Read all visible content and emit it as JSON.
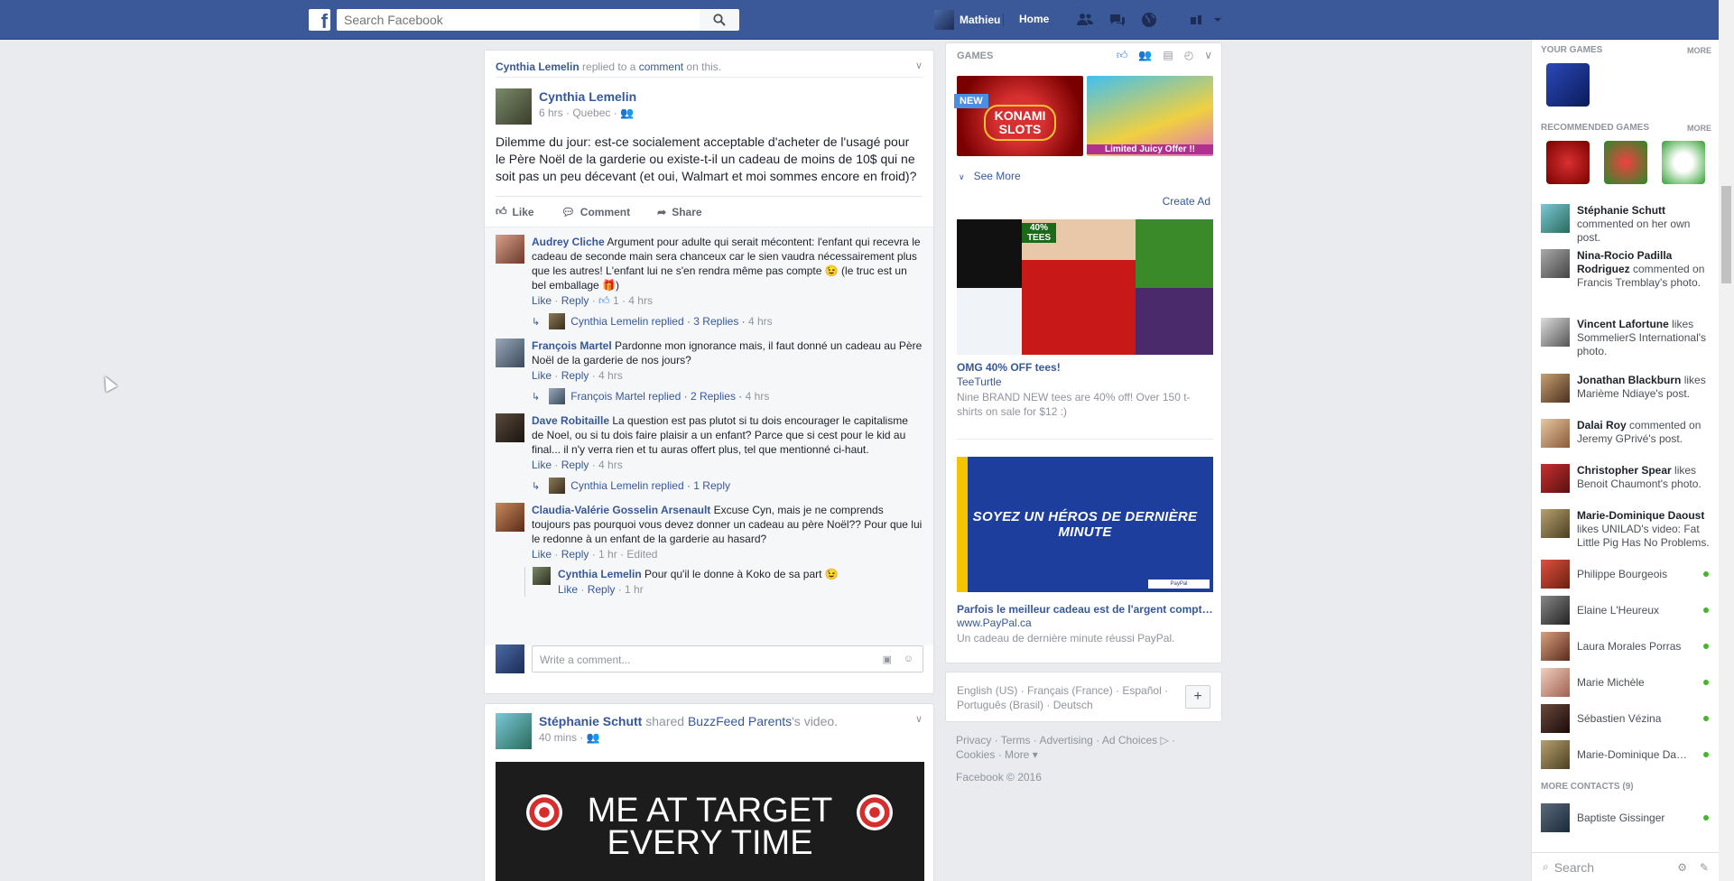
{
  "topbar": {
    "logo": "f",
    "search_placeholder": "Search Facebook",
    "user_name": "Mathieu",
    "home_label": "Home",
    "colors": {
      "bar": "#3b5998"
    }
  },
  "post1": {
    "header": {
      "actor": "Cynthia Lemelin",
      "action": " replied to a ",
      "target": "comment",
      "tail": " on this."
    },
    "author": "Cynthia Lemelin",
    "meta": "6 hrs · Quebec · ",
    "text": "Dilemme du jour: est-ce socialement acceptable d'acheter de l'usagé pour le Père Noël de la garderie ou existe-t-il un cadeau de moins de 10$ qui ne soit pas un peu décevant (et oui, Walmart et moi sommes encore en froid)?",
    "actions": {
      "like": "Like",
      "comment": "Comment",
      "share": "Share"
    },
    "comments": [
      {
        "author": "Audrey Cliche",
        "text": " Argument pour adulte qui serait mécontent: l'enfant qui recevra le cadeau de seconde main sera chanceux car le sien vaudra nécessairement plus que les autres! L'enfant lui ne s'en rendra même pas compte 😉 (le truc est un bel emballage 🎁)",
        "like": "Like",
        "reply": "Reply",
        "reactions": "1",
        "time": "4 hrs",
        "reply_summary": {
          "who": "Cynthia Lemelin replied",
          "count": "3 Replies",
          "time": "4 hrs"
        }
      },
      {
        "author": "François Martel",
        "text": " Pardonne mon ignorance mais, il faut donné un cadeau au Père Noël de la garderie de nos jours?",
        "like": "Like",
        "reply": "Reply",
        "time": "4 hrs",
        "reply_summary": {
          "who": "François Martel replied",
          "count": "2 Replies",
          "time": "4 hrs"
        }
      },
      {
        "author": "Dave Robitaille",
        "text": " La question est pas plutot si tu dois encourager le capitalisme de Noel, ou si tu dois faire plaisir a un enfant? Parce que si cest pour le kid au final... il n'y verra rien et tu auras offert plus, tel que mentionné ci-haut.",
        "like": "Like",
        "reply": "Reply",
        "time": "4 hrs",
        "reply_summary": {
          "who": "Cynthia Lemelin replied",
          "count": "1 Reply",
          "time": ""
        }
      },
      {
        "author": "Claudia-Valérie Gosselin Arsenault",
        "text": " Excuse Cyn, mais je ne comprends toujours pas pourquoi vous devez donner un cadeau au père Noël?? Pour que lui le redonne à un enfant de la garderie au hasard?",
        "like": "Like",
        "reply": "Reply",
        "time": "1 hr",
        "edited": "Edited"
      }
    ],
    "subcomment": {
      "author": "Cynthia Lemelin",
      "text": " Pour qu'il le donne à Koko de sa part 😉",
      "like": "Like",
      "reply": "Reply",
      "time": "1 hr"
    },
    "write_placeholder": "Write a comment..."
  },
  "post2": {
    "author": "Stéphanie Schutt",
    "action": " shared ",
    "target": "BuzzFeed Parents",
    "tail": "'s video.",
    "meta": "40 mins · ",
    "video_line1": "ME AT TARGET",
    "video_line2": "EVERY TIME"
  },
  "rcol": {
    "games_header": "GAMES",
    "game1_badge": "NEW",
    "game1_name": "KONAMI SLOTS",
    "game2_banner": "Limited Juicy Offer !!",
    "see_more": "See More",
    "create_ad": "Create Ad",
    "ad1": {
      "title": "OMG 40% OFF tees!",
      "url": "TeeTurtle",
      "desc": "Nine BRAND NEW tees are 40% off! Over 150 t-shirts on sale for $12 :)",
      "badge": "40% TEES"
    },
    "ad2": {
      "image_text": "SOYEZ UN HÉROS DE DERNIÈRE MINUTE",
      "logo": "PayPal",
      "title": "Parfois le meilleur cadeau est de l'argent compt…",
      "url": "www.PayPal.ca",
      "desc": "Un cadeau de dernière minute réussi PayPal."
    },
    "languages": "English (US) · Français (France) · Español · Português (Brasil) · Deutsch",
    "plus": "+",
    "footer": "Privacy · Terms · Advertising · Ad Choices ▷ · Cookies · More ▾",
    "copyright": "Facebook © 2016"
  },
  "sidebar": {
    "your_games": "YOUR GAMES",
    "more1": "MORE",
    "recommended": "RECOMMENDED GAMES",
    "more2": "MORE",
    "ticker": [
      {
        "who": "Stéphanie Schutt",
        "text": " commented on her own post."
      },
      {
        "who": "Nina-Rocio Padilla Rodriguez",
        "text": " commented on Francis Tremblay's photo."
      },
      {
        "who": "Vincent Lafortune",
        "text": " likes SommelierS International's photo."
      },
      {
        "who": "Jonathan Blackburn",
        "text": " likes Marième Ndiaye's post."
      },
      {
        "who": "Dalai Roy",
        "text": " commented on Jeremy GPrivé's post."
      },
      {
        "who": "Christopher Spear",
        "text": " likes Benoit Chaumont's photo."
      },
      {
        "who": "Marie-Dominique Daoust",
        "text": " likes UNILAD's video: Fat Little Pig Has No Problems."
      }
    ],
    "contacts": [
      "Philippe Bourgeois",
      "Elaine L'Heureux",
      "Laura Morales Porras",
      "Marie Michèle",
      "Sébastien Vézina",
      "Marie-Dominique Da…"
    ],
    "more_contacts": "MORE CONTACTS (9)",
    "more_contact1": "Baptiste Gissinger",
    "search_placeholder": "Search"
  }
}
